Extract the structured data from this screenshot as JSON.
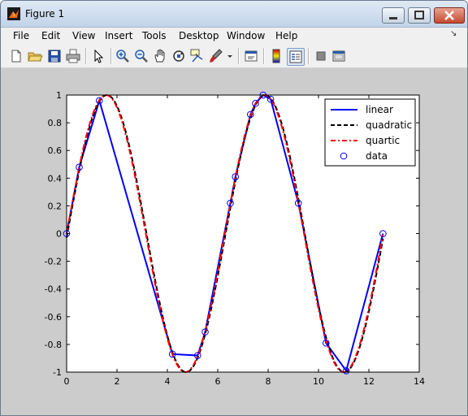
{
  "window": {
    "title": "Figure 1"
  },
  "menu": [
    "File",
    "Edit",
    "View",
    "Insert",
    "Tools",
    "Desktop",
    "Window",
    "Help"
  ],
  "toolbar": [
    "new-figure-icon",
    "open-file-icon",
    "save-icon",
    "print-icon",
    "pointer-icon",
    "zoom-in-icon",
    "zoom-out-icon",
    "pan-icon",
    "rotate-3d-icon",
    "data-cursor-icon",
    "brush-icon",
    "link-plot-icon",
    "colorbar-icon",
    "legend-icon",
    "hide-plot-tools-icon",
    "show-plot-tools-icon"
  ],
  "chart_data": {
    "type": "line",
    "xlim": [
      0,
      14
    ],
    "ylim": [
      -1,
      1
    ],
    "xticks": [
      0,
      2,
      4,
      6,
      8,
      10,
      12,
      14
    ],
    "yticks": [
      1,
      0.8,
      0.6,
      0.4,
      0.2,
      0,
      -0.2,
      -0.4,
      -0.6,
      -0.8,
      -1
    ],
    "grid": false,
    "legend_position": "top-right",
    "data_points": {
      "x": [
        0,
        0.5,
        1.3,
        4.2,
        5.2,
        5.5,
        6.5,
        6.7,
        7.3,
        7.5,
        7.8,
        8.1,
        9.2,
        10.3,
        11.1,
        12.56
      ],
      "y": [
        0,
        0.48,
        0.96,
        -0.87,
        -0.88,
        -0.71,
        0.22,
        0.41,
        0.86,
        0.94,
        1.0,
        0.97,
        0.22,
        -0.79,
        -0.99,
        0.0
      ]
    },
    "series": [
      {
        "name": "linear",
        "color": "#0000ff",
        "style": "solid",
        "x_ref": "data_points"
      },
      {
        "name": "quadratic",
        "color": "#000000",
        "style": "dashed",
        "function": "sin(x)"
      },
      {
        "name": "quartic",
        "color": "#ff0000",
        "style": "dash-dot",
        "function": "sin(x)"
      },
      {
        "name": "data",
        "color": "#0000ff",
        "style": "circle-markers",
        "x_ref": "data_points"
      }
    ]
  }
}
